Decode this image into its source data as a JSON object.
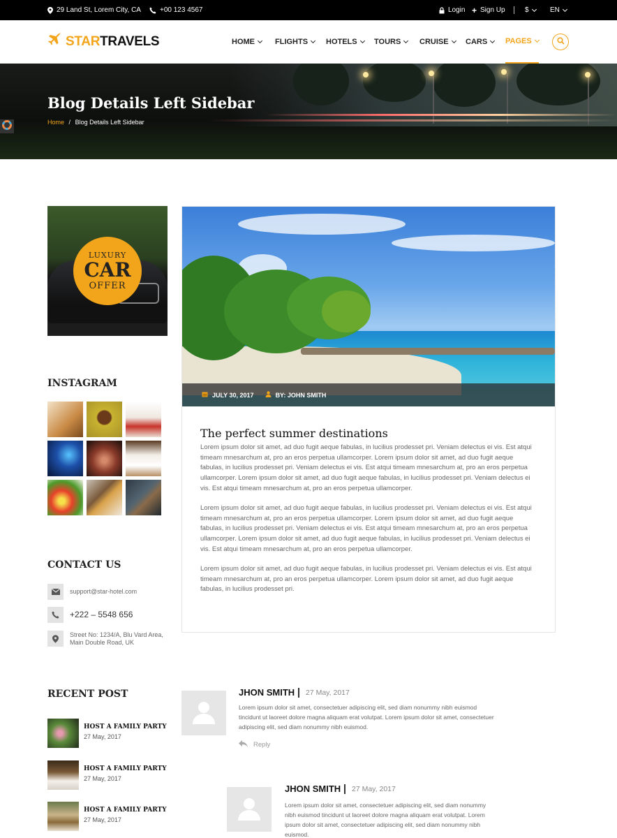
{
  "topbar": {
    "address": "29 Land St, Lorem City, CA",
    "phone": "+00 123 4567",
    "login": "Login",
    "signup": "Sign Up",
    "currency": "$",
    "language": "EN"
  },
  "brand": {
    "name_part1": "STAR",
    "name_part2": "TRAVELS",
    "accent": "#f2a51a"
  },
  "nav": {
    "items": [
      {
        "label": "HOME"
      },
      {
        "label": "FLIGHTS"
      },
      {
        "label": "HOTELS"
      },
      {
        "label": "TOURS"
      },
      {
        "label": "CRUISE"
      },
      {
        "label": "CARS"
      },
      {
        "label": "PAGES"
      }
    ],
    "active": "PAGES"
  },
  "banner": {
    "title": "Blog Details Left Sidebar",
    "breadcrumb_home": "Home",
    "breadcrumb_sep": "/",
    "breadcrumb_current": "Blog Details Left Sidebar"
  },
  "sidebar": {
    "ad": {
      "line1": "LUXURY",
      "line2": "CAR",
      "line3": "OFFER"
    },
    "instagram_heading": "INSTAGRAM",
    "contact_heading": "CONTACT US",
    "contact_email": "support@star-hotel.com",
    "contact_phone": "+222 – 5548 656",
    "contact_address_line1": "Street No: 1234/A, Blu Vard Area,",
    "contact_address_line2": "Main Double Road, UK",
    "recent_heading": "RECENT POST",
    "recent_posts": [
      {
        "title": "HOST A FAMILY PARTY",
        "date": "27 May, 2017"
      },
      {
        "title": "HOST A FAMILY PARTY",
        "date": "27 May, 2017"
      },
      {
        "title": "HOST A FAMILY PARTY",
        "date": "27 May, 2017"
      }
    ]
  },
  "article": {
    "date": "JULY 30, 2017",
    "author": "BY: JOHN SMITH",
    "title": "The perfect summer destinations",
    "paragraphs": [
      "Lorem ipsum dolor sit amet, ad duo fugit aeque fabulas, in lucilius prodesset pri. Veniam delectus ei vis. Est atqui timeam mnesarchum at, pro an eros perpetua ullamcorper. Lorem ipsum dolor sit amet, ad duo fugit aeque fabulas, in lucilius prodesset pri. Veniam delectus ei vis. Est atqui timeam mnesarchum at, pro an eros perpetua ullamcorper. Lorem ipsum dolor sit amet, ad duo fugit aeque fabulas, in lucilius prodesset pri. Veniam delectus ei vis. Est atqui timeam mnesarchum at, pro an eros perpetua ullamcorper.",
      "Lorem ipsum dolor sit amet, ad duo fugit aeque fabulas, in lucilius prodesset pri. Veniam delectus ei vis. Est atqui timeam mnesarchum at, pro an eros perpetua ullamcorper. Lorem ipsum dolor sit amet, ad duo fugit aeque fabulas, in lucilius prodesset pri. Veniam delectus ei vis. Est atqui timeam mnesarchum at, pro an eros perpetua ullamcorper. Lorem ipsum dolor sit amet, ad duo fugit aeque fabulas, in lucilius prodesset pri. Veniam delectus ei vis. Est atqui timeam mnesarchum at, pro an eros perpetua ullamcorper.",
      "Lorem ipsum dolor sit amet, ad duo fugit aeque fabulas, in lucilius prodesset pri. Veniam delectus ei vis. Est atqui timeam mnesarchum at, pro an eros perpetua ullamcorper. Lorem ipsum dolor sit amet, ad duo fugit aeque fabulas, in lucilius prodesset pri."
    ]
  },
  "comments": [
    {
      "name": "JHON SMITH",
      "date": "27 May, 2017",
      "text": "Lorem ipsum dolor sit amet, consectetuer adipiscing elit, sed diam nonummy nibh euismod tincidunt ut laoreet dolore magna aliquam erat volutpat. Lorem ipsum dolor sit amet, consectetuer adipiscing elit, sed diam nonummy nibh euismod.",
      "reply": "Reply"
    },
    {
      "name": "JHON SMITH",
      "date": "27 May, 2017",
      "text": "Lorem ipsum dolor sit amet, consectetuer adipiscing elit, sed diam nonummy nibh euismod tincidunt ut laoreet dolore magna aliquam erat volutpat. Lorem ipsum dolor sit amet, consectetuer adipiscing elit, sed diam nonummy nibh euismod."
    }
  ]
}
